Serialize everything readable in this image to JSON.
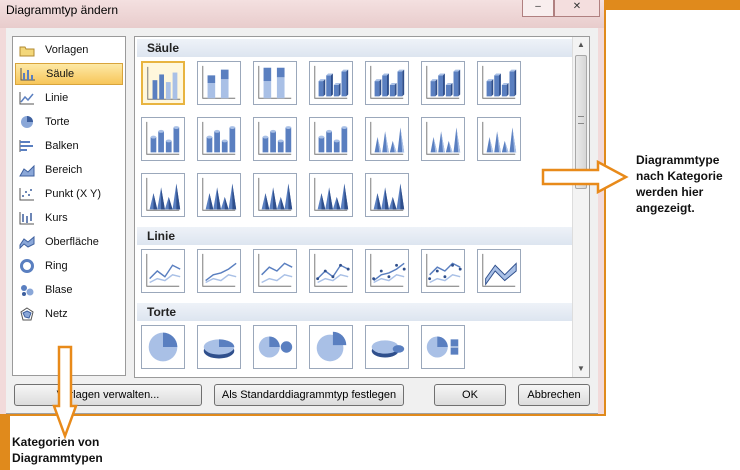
{
  "dialog": {
    "title": "Diagrammtyp ändern",
    "minimize": "–",
    "close": "✕"
  },
  "categories": [
    {
      "label": "Vorlagen",
      "icon": "folder-icon"
    },
    {
      "label": "Säule",
      "icon": "column-chart-icon",
      "selected": true
    },
    {
      "label": "Linie",
      "icon": "line-chart-icon"
    },
    {
      "label": "Torte",
      "icon": "pie-chart-icon"
    },
    {
      "label": "Balken",
      "icon": "bar-chart-icon"
    },
    {
      "label": "Bereich",
      "icon": "area-chart-icon"
    },
    {
      "label": "Punkt (X Y)",
      "icon": "scatter-chart-icon"
    },
    {
      "label": "Kurs",
      "icon": "stock-chart-icon"
    },
    {
      "label": "Oberfläche",
      "icon": "surface-chart-icon"
    },
    {
      "label": "Ring",
      "icon": "doughnut-chart-icon"
    },
    {
      "label": "Blase",
      "icon": "bubble-chart-icon"
    },
    {
      "label": "Netz",
      "icon": "radar-chart-icon"
    }
  ],
  "gallery": {
    "sections": [
      {
        "title": "Säule",
        "count": 19
      },
      {
        "title": "Linie",
        "count": 7
      },
      {
        "title": "Torte",
        "count": 6
      }
    ]
  },
  "buttons": {
    "manage_templates": "Vorlagen verwalten...",
    "set_default": "Als Standarddiagrammtyp festlegen",
    "ok": "OK",
    "cancel": "Abbrechen"
  },
  "annotations": {
    "right_line1": "Diagrammtype",
    "right_line2": "nach Kategorie",
    "right_line3": "werden hier",
    "right_line4": "angezeigt.",
    "bottom_line1": "Kategorien von",
    "bottom_line2": "Diagrammtypen"
  },
  "colors": {
    "background_orange": "#e08a1c",
    "arrow_orange": "#e88a1a",
    "selection": "#f7c65a",
    "chart_blue": "#5a7fc0"
  }
}
